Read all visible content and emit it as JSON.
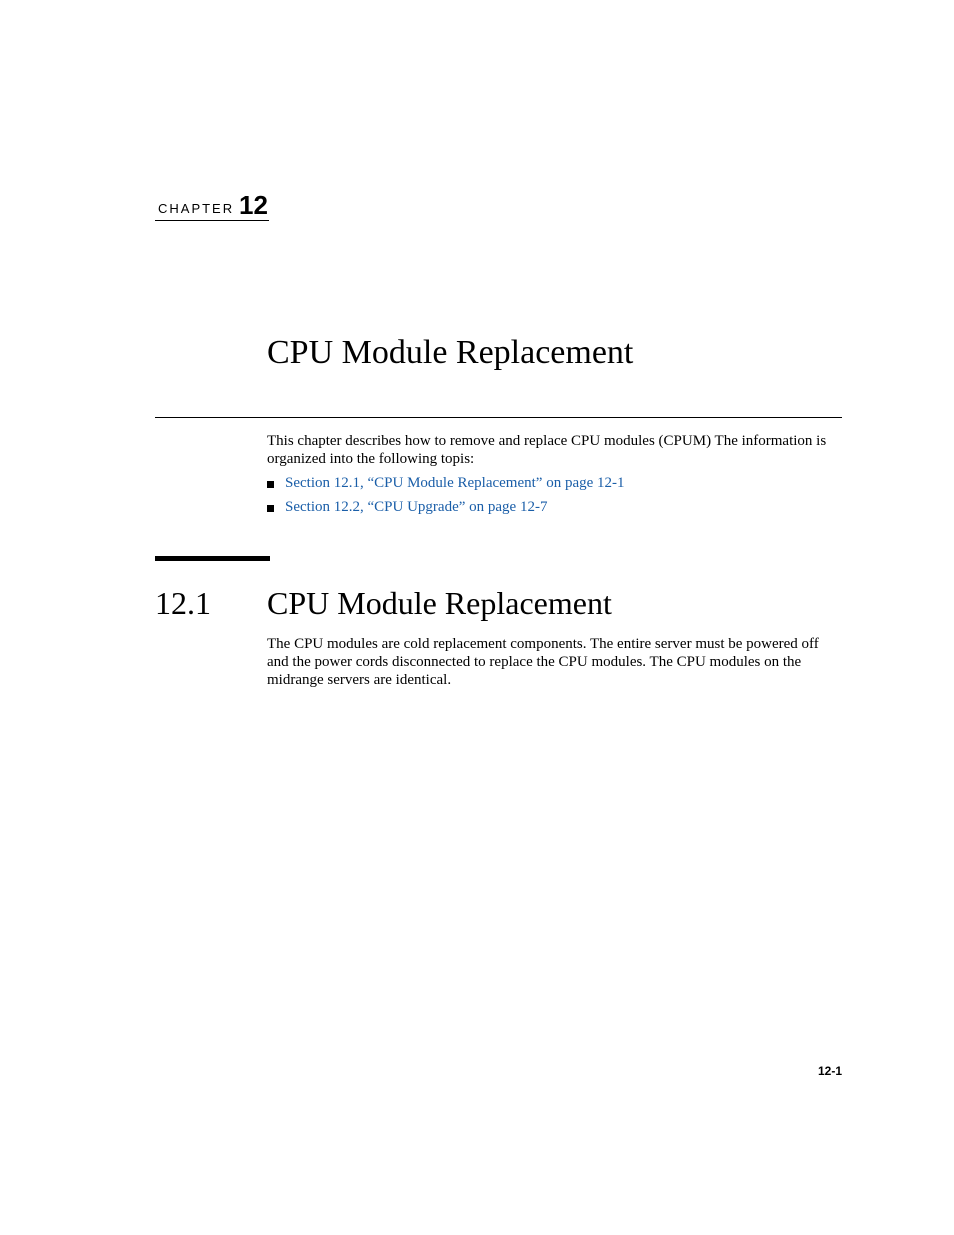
{
  "chapter": {
    "label": "CHAPTER",
    "number": "12",
    "title": "CPU Module Replacement"
  },
  "intro": {
    "text": "This chapter describes how to remove and replace CPU modules (CPUM) The information is organized into the following topis:",
    "topics": [
      {
        "label": "Section 12.1, “CPU Module Replacement” on page 12-1"
      },
      {
        "label": "Section 12.2, “CPU Upgrade” on page 12-7"
      }
    ]
  },
  "section": {
    "number": "12.1",
    "title": "CPU Module Replacement",
    "body": "The CPU modules are cold replacement components. The entire server must be powered off and the power cords disconnected to replace the CPU modules. The CPU modules on the midrange servers are identical."
  },
  "footer": {
    "page_number": "12-1"
  },
  "colors": {
    "link": "#1a5ea8"
  }
}
